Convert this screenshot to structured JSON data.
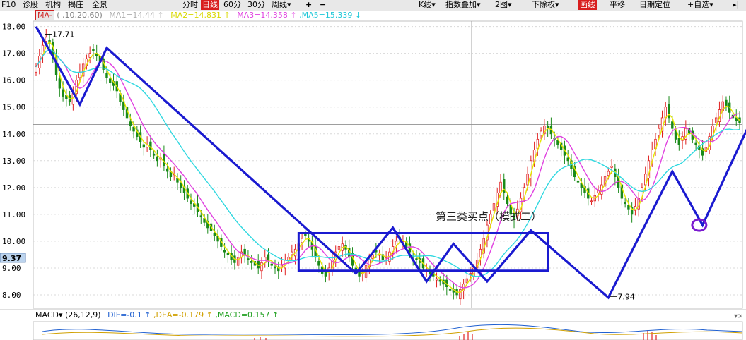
{
  "toolbar": {
    "left_items": [
      "F10",
      "诊股",
      "机构",
      "揭庄",
      "全景"
    ],
    "center_items": [
      "分时",
      "日线",
      "60分",
      "30分",
      "周线▾",
      "+",
      "−"
    ],
    "right_items": [
      "K线▾",
      "指数叠加▾",
      "2图▾",
      "下除权▾",
      "画线",
      "平移",
      "日期定位",
      "+自选▾",
      "▸|"
    ],
    "active_period": "日线",
    "active_tool": "画线"
  },
  "ma_legend": {
    "label": "MA-",
    "params": "( ,10,20,60)",
    "ma1": "MA1=14.44 ↑",
    "ma2": "MA2=14.831 ↑",
    "ma3": "MA3=14.358 ↑",
    "ma5": ",MA5=15.339 ↓"
  },
  "macd_legend": {
    "label": "MACD▾ (26,12,9)",
    "dif": "DIF=-0.1 ↑",
    "dea": ",DEA=-0.179 ↑",
    "macd": ",MACD=0.157 ↑"
  },
  "colors": {
    "up": "#e02020",
    "down": "#1a8a1a",
    "ma1": "#b0b0b0",
    "ma2": "#e6e600",
    "ma3": "#e040e0",
    "ma5": "#30d8e0",
    "drawing": "#1a1ad0",
    "annotation": "#7a1ad0"
  },
  "current_price_tag": "9.37",
  "annotation_text": "第三类买点（模式二）",
  "chart_data": {
    "type": "candlestick",
    "title": "",
    "y_ticks": [
      "18.00",
      "17.00",
      "16.00",
      "15.00",
      "14.00",
      "13.00",
      "12.00",
      "11.00",
      "10.00",
      "9.00",
      "8.00"
    ],
    "ylim": [
      7.5,
      18.2
    ],
    "high_label": "17.71",
    "low_label": "7.94",
    "zigzag_points": [
      [
        0,
        18.0
      ],
      [
        13,
        15.1
      ],
      [
        21,
        17.2
      ],
      [
        95,
        8.8
      ],
      [
        106,
        10.5
      ],
      [
        116,
        8.5
      ],
      [
        124,
        9.9
      ],
      [
        134,
        8.5
      ],
      [
        147,
        10.4
      ],
      [
        170,
        7.9
      ],
      [
        189,
        12.6
      ],
      [
        198,
        10.6
      ],
      [
        215,
        15.2
      ]
    ],
    "pivot_box": {
      "x_from": 78,
      "x_to": 152,
      "low": 8.9,
      "high": 10.3
    },
    "circle_marker": {
      "x": 197,
      "y": 10.6
    },
    "price_series": [
      16.5,
      16.9,
      17.3,
      17.6,
      17.4,
      16.8,
      16.2,
      15.7,
      15.4,
      15.3,
      15.2,
      15.5,
      16.0,
      16.3,
      16.6,
      16.8,
      17.0,
      17.1,
      16.9,
      16.7,
      16.4,
      16.1,
      15.9,
      15.8,
      15.6,
      15.2,
      14.9,
      14.6,
      14.3,
      14.1,
      13.9,
      13.7,
      13.5,
      13.6,
      13.4,
      13.2,
      13.0,
      13.1,
      12.8,
      12.6,
      12.4,
      12.5,
      12.2,
      12.0,
      11.8,
      11.6,
      11.4,
      11.3,
      11.1,
      10.9,
      10.7,
      10.5,
      10.4,
      10.2,
      10.0,
      9.8,
      9.6,
      9.5,
      9.3,
      9.2,
      9.4,
      9.6,
      9.5,
      9.3,
      9.2,
      9.1,
      9.0,
      9.2,
      9.4,
      9.3,
      9.1,
      9.0,
      8.9,
      9.1,
      9.3,
      9.4,
      9.6,
      9.7,
      9.9,
      10.1,
      10.2,
      10.0,
      9.7,
      9.4,
      9.1,
      8.8,
      8.7,
      9.0,
      9.3,
      9.6,
      9.8,
      9.9,
      9.7,
      9.4,
      9.1,
      8.9,
      8.7,
      8.8,
      9.1,
      9.3,
      9.5,
      9.6,
      9.5,
      9.3,
      9.4,
      9.6,
      9.8,
      10.0,
      10.1,
      10.0,
      9.8,
      9.6,
      9.4,
      9.3,
      9.2,
      9.0,
      8.9,
      8.8,
      8.7,
      8.6,
      8.5,
      8.4,
      8.3,
      8.2,
      8.1,
      8.0,
      8.2,
      8.4,
      8.6,
      8.8,
      9.0,
      9.3,
      9.7,
      10.1,
      10.6,
      11.0,
      11.4,
      11.8,
      12.2,
      11.8,
      11.4,
      11.0,
      10.8,
      11.2,
      11.6,
      12.0,
      12.5,
      13.0,
      13.4,
      13.8,
      14.1,
      14.3,
      14.2,
      14.0,
      13.8,
      13.6,
      13.4,
      13.2,
      13.0,
      12.7,
      12.4,
      12.2,
      12.0,
      11.8,
      11.6,
      11.5,
      11.7,
      11.9,
      12.1,
      12.4,
      12.6,
      12.8,
      12.4,
      12.0,
      11.6,
      11.4,
      11.2,
      11.0,
      11.3,
      11.6,
      12.0,
      12.5,
      13.0,
      13.4,
      13.8,
      14.2,
      14.6,
      15.0,
      14.6,
      14.2,
      13.8,
      13.6,
      13.9,
      14.2,
      14.0,
      13.8,
      13.6,
      13.4,
      13.2,
      13.5,
      13.9,
      14.3,
      14.6,
      14.9,
      15.2,
      15.0,
      14.8,
      14.6,
      14.5,
      14.4
    ]
  }
}
